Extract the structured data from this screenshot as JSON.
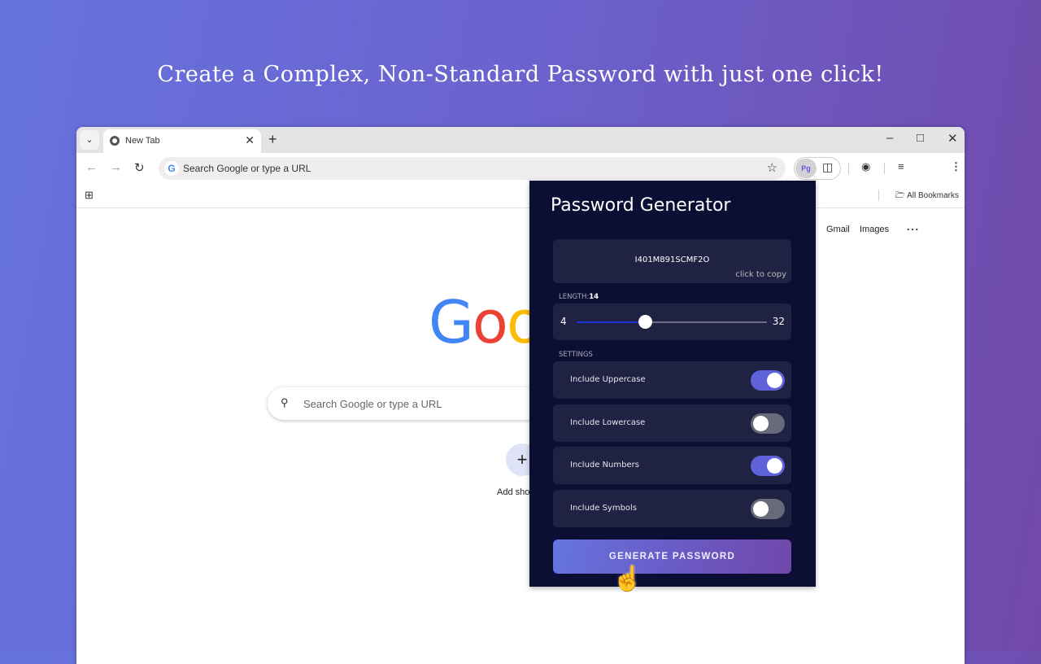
{
  "headline": "Create a Complex, Non-Standard Password with just one click!",
  "browser": {
    "tab_title": "New Tab",
    "omnibox_placeholder": "Search Google or type a URL",
    "extension_badge": "Pg",
    "all_bookmarks": "All Bookmarks"
  },
  "newtab": {
    "gmail": "Gmail",
    "images": "Images",
    "logo": "Google",
    "search_placeholder": "Search Google or type a URL",
    "add_shortcut": "Add shortcut"
  },
  "popup": {
    "title": "Password Generator",
    "password": "I401M891SCMF2O",
    "copy_hint": "click to copy",
    "length_label": "LENGTH:",
    "length_value": "14",
    "length": 14,
    "min": "4",
    "max": "32",
    "settings_label": "SETTINGS",
    "options": [
      {
        "label": "Include Uppercase",
        "enabled": true
      },
      {
        "label": "Include Lowercase",
        "enabled": false
      },
      {
        "label": "Include Numbers",
        "enabled": true
      },
      {
        "label": "Include Symbols",
        "enabled": false
      }
    ],
    "generate_label": "GENERATE PASSWORD",
    "accent": "#5e63dc"
  }
}
